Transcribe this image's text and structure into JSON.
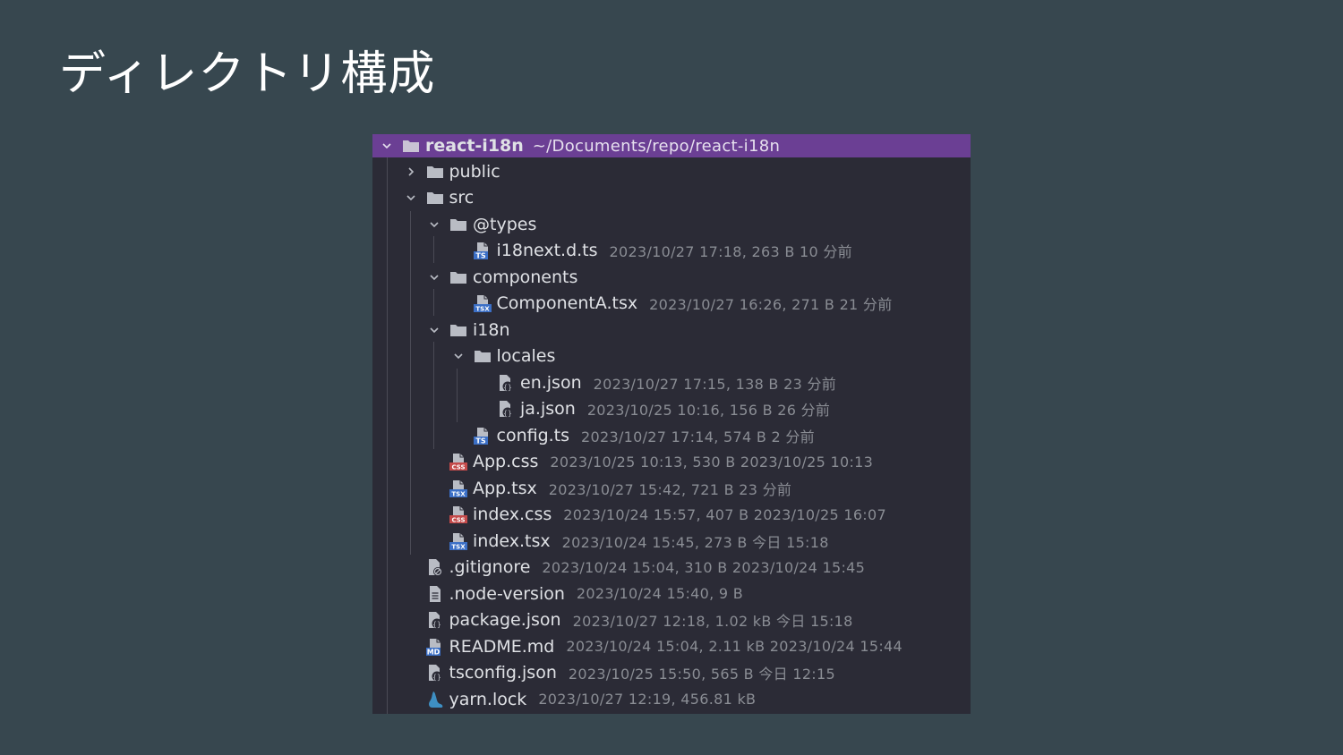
{
  "slide_title": "ディレクトリ構成",
  "root": {
    "name": "react-i18n",
    "path": "~/Documents/repo/react-i18n"
  },
  "rows": [
    {
      "name": "public",
      "meta": ""
    },
    {
      "name": "src",
      "meta": ""
    },
    {
      "name": "@types",
      "meta": ""
    },
    {
      "name": "i18next.d.ts",
      "meta": "2023/10/27 17:18, 263 B 10 分前"
    },
    {
      "name": "components",
      "meta": ""
    },
    {
      "name": "ComponentA.tsx",
      "meta": "2023/10/27 16:26, 271 B 21 分前"
    },
    {
      "name": "i18n",
      "meta": ""
    },
    {
      "name": "locales",
      "meta": ""
    },
    {
      "name": "en.json",
      "meta": "2023/10/27 17:15, 138 B 23 分前"
    },
    {
      "name": "ja.json",
      "meta": "2023/10/25 10:16, 156 B 26 分前"
    },
    {
      "name": "config.ts",
      "meta": "2023/10/27 17:14, 574 B 2 分前"
    },
    {
      "name": "App.css",
      "meta": "2023/10/25 10:13, 530 B 2023/10/25 10:13"
    },
    {
      "name": "App.tsx",
      "meta": "2023/10/27 15:42, 721 B 23 分前"
    },
    {
      "name": "index.css",
      "meta": "2023/10/24 15:57, 407 B 2023/10/25 16:07"
    },
    {
      "name": "index.tsx",
      "meta": "2023/10/24 15:45, 273 B 今日 15:18"
    },
    {
      "name": ".gitignore",
      "meta": "2023/10/24 15:04, 310 B 2023/10/24 15:45"
    },
    {
      "name": ".node-version",
      "meta": "2023/10/24 15:40, 9 B"
    },
    {
      "name": "package.json",
      "meta": "2023/10/27 12:18, 1.02 kB 今日 15:18"
    },
    {
      "name": "README.md",
      "meta": "2023/10/24 15:04, 2.11 kB 2023/10/24 15:44"
    },
    {
      "name": "tsconfig.json",
      "meta": "2023/10/25 15:50, 565 B 今日 12:15"
    },
    {
      "name": "yarn.lock",
      "meta": "2023/10/27 12:19, 456.81 kB"
    }
  ],
  "badges": {
    "ts": "TS",
    "tsx": "TSX",
    "css": "CSS",
    "md": "MD"
  },
  "colors": {
    "background": "#37474f",
    "panel": "#2b2b36",
    "selected_row": "#6b3f94",
    "folder": "#b9bcc4",
    "ts_badge": "#3b6fc6",
    "css_badge": "#c44a4a",
    "yarn": "#3e8fc3"
  }
}
